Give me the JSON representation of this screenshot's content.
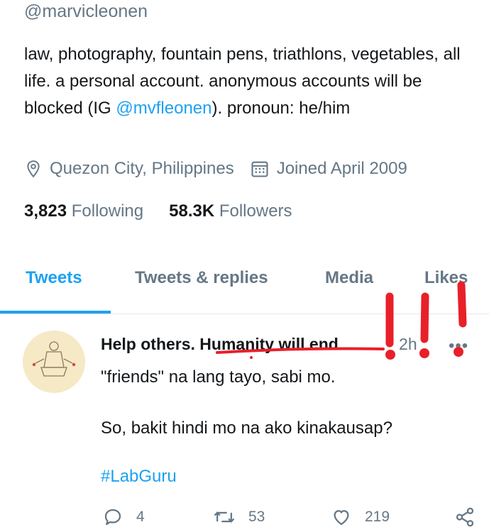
{
  "profile": {
    "handle": "@marvicleonen",
    "bio_part1": "law, photography, fountain pens, triathlons, vegetables, all life. a personal account. anonymous accounts will be blocked (IG ",
    "bio_link": "@mvfleonen",
    "bio_part2": "). pronoun: he/him",
    "location": "Quezon City, Philippines",
    "joined": "Joined April 2009",
    "following_count": "3,823",
    "following_label": "Following",
    "followers_count": "58.3K",
    "followers_label": "Followers"
  },
  "tabs": [
    {
      "label": "Tweets",
      "active": true
    },
    {
      "label": "Tweets & replies",
      "active": false
    },
    {
      "label": "Media",
      "active": false
    },
    {
      "label": "Likes",
      "active": false
    }
  ],
  "tweet": {
    "author_name": "Help others. Humanity will end...",
    "time": "· 2h",
    "more": "•••",
    "line1": "\"friends\" na lang tayo, sabi mo.",
    "line2": "So, bakit hindi mo na ako kinakausap?",
    "hashtag": "#LabGuru",
    "replies": "4",
    "retweets": "53",
    "likes": "219"
  },
  "icons": {
    "location": "location-pin-icon",
    "calendar": "calendar-icon",
    "reply": "reply-icon",
    "retweet": "retweet-icon",
    "like": "heart-icon",
    "share": "share-icon"
  },
  "colors": {
    "accent": "#1da1f2",
    "secondary_text": "#657786",
    "annotation": "#e8202a"
  }
}
